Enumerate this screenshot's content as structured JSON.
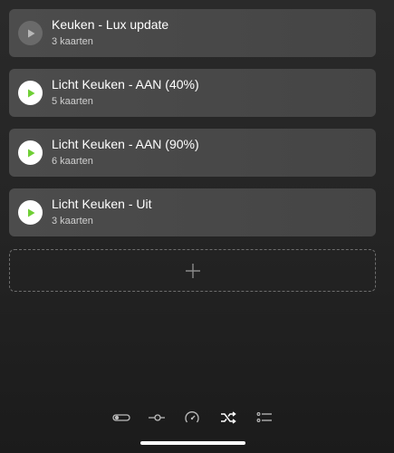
{
  "flows": [
    {
      "title": "Keuken - Lux update",
      "subtitle": "3 kaarten",
      "enabled": false
    },
    {
      "title": "Licht Keuken - AAN (40%)",
      "subtitle": "5 kaarten",
      "enabled": true
    },
    {
      "title": "Licht Keuken - AAN (90%)",
      "subtitle": "6 kaarten",
      "enabled": true
    },
    {
      "title": "Licht Keuken - Uit",
      "subtitle": "3 kaarten",
      "enabled": true
    }
  ],
  "add_card": {
    "icon": "plus-icon"
  },
  "nav": {
    "items": [
      {
        "icon": "toggle-icon"
      },
      {
        "icon": "slider-icon"
      },
      {
        "icon": "speedometer-icon"
      },
      {
        "icon": "shuffle-icon",
        "active": true
      },
      {
        "icon": "list-icon"
      }
    ]
  },
  "colors": {
    "accent": "#6fcf35",
    "card": "#4a4a4a",
    "background": "#252525",
    "disabled": "#6a6a6a"
  }
}
